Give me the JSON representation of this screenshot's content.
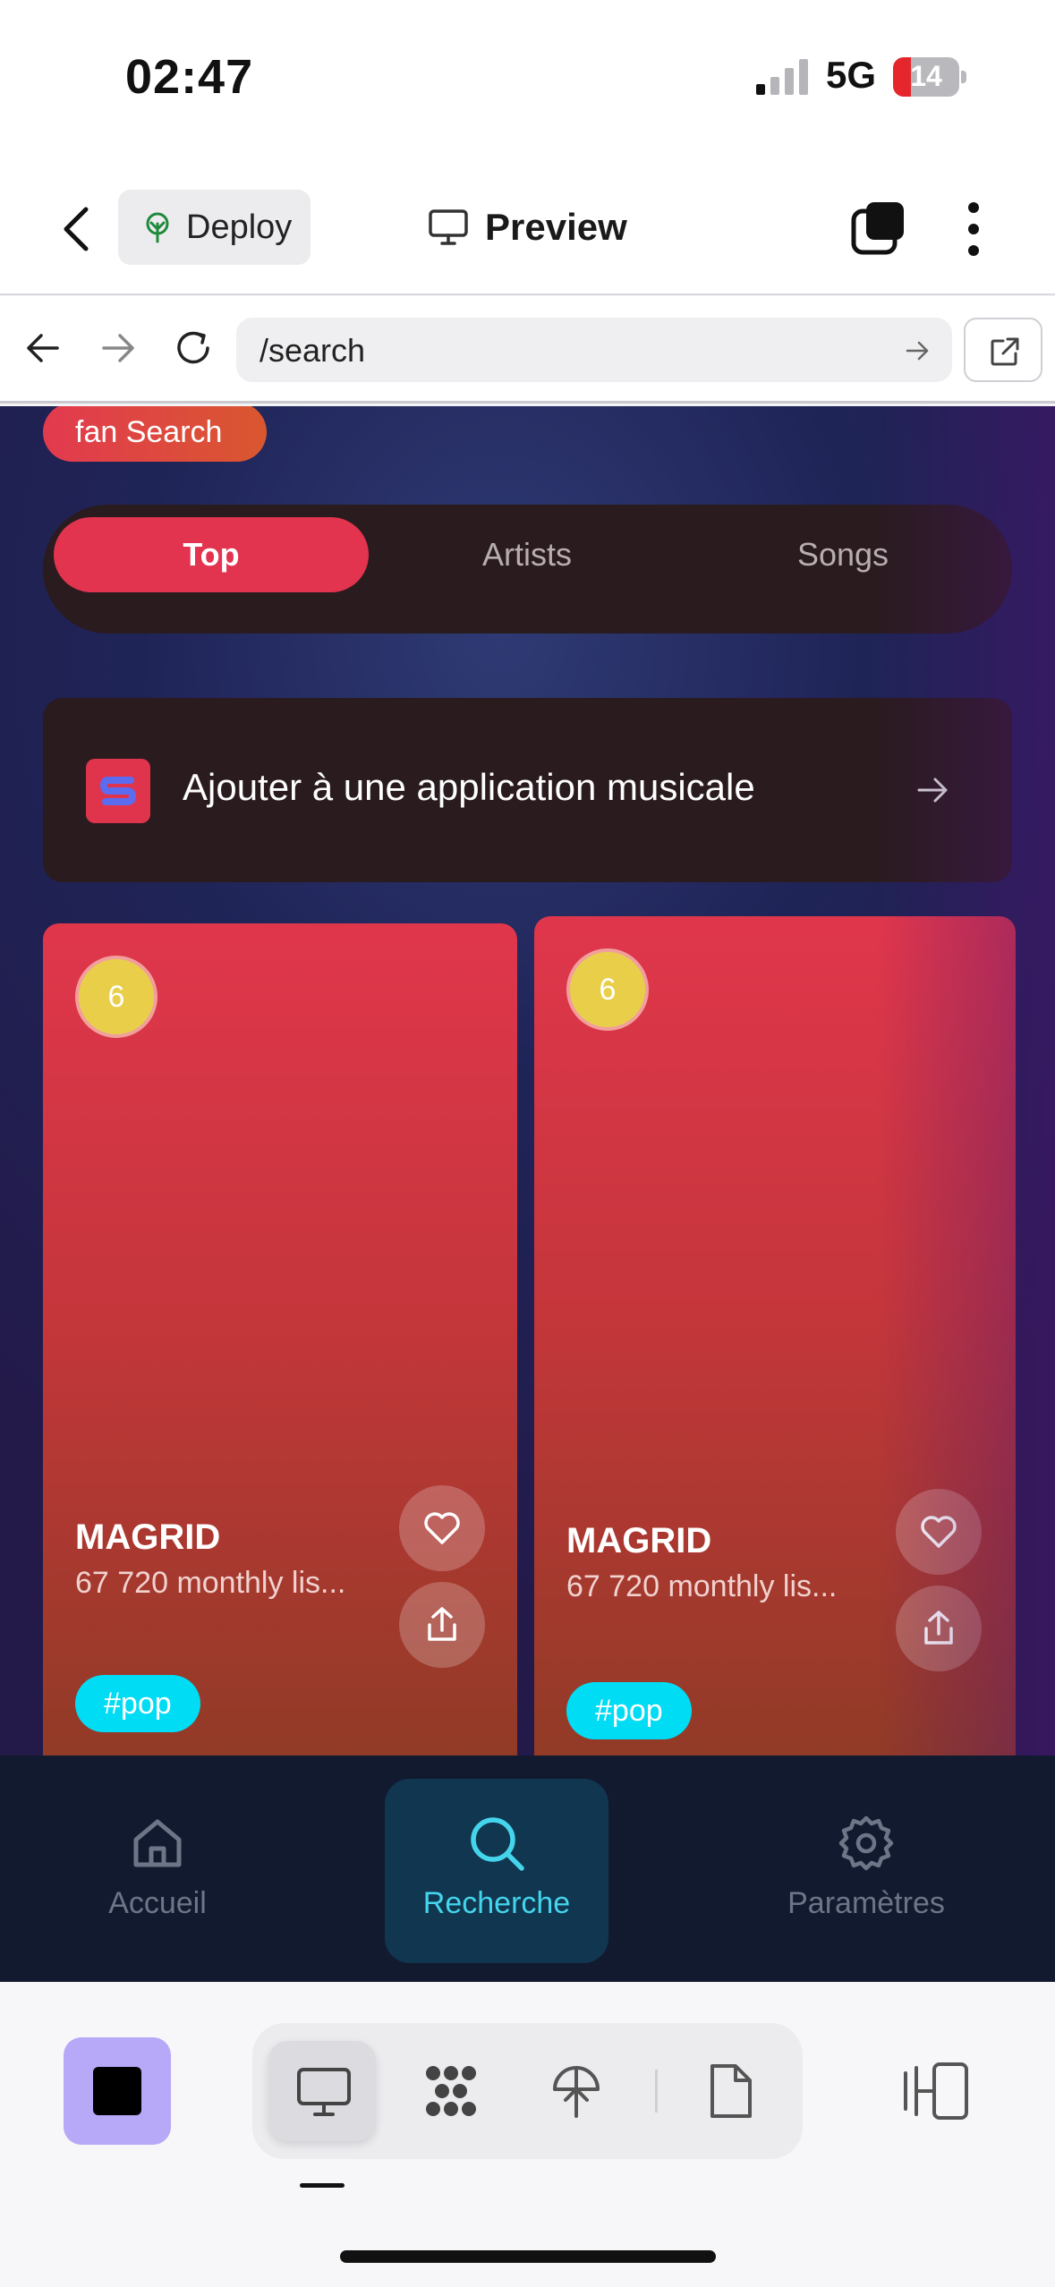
{
  "status_bar": {
    "time": "02:47",
    "network": "5G",
    "battery": "14",
    "battery_level": 0.14
  },
  "header": {
    "deploy_label": "Deploy",
    "title": "Preview"
  },
  "url_bar": {
    "path": "/search"
  },
  "page": {
    "chip_label": "fan Search",
    "tabs": [
      {
        "label": "Top",
        "active": true
      },
      {
        "label": "Artists",
        "active": false
      },
      {
        "label": "Songs",
        "active": false
      }
    ],
    "banner_label": "Ajouter à une application musicale",
    "cards": [
      {
        "rank": "6",
        "name": "MAGRID",
        "listeners": "67 720 monthly lis...",
        "tag": "#pop"
      },
      {
        "rank": "6",
        "name": "MAGRID",
        "listeners": "67 720 monthly lis...",
        "tag": "#pop"
      }
    ]
  },
  "app_nav": {
    "items": [
      {
        "label": "Accueil",
        "icon": "home-icon",
        "active": false
      },
      {
        "label": "Recherche",
        "icon": "search-icon",
        "active": true
      },
      {
        "label": "Paramètres",
        "icon": "gear-icon",
        "active": false
      }
    ]
  },
  "colors": {
    "accent": "#e2334f",
    "tag": "#00dcf4",
    "nav_active": "#44d5ec",
    "stop_button": "#b7a8f8"
  }
}
